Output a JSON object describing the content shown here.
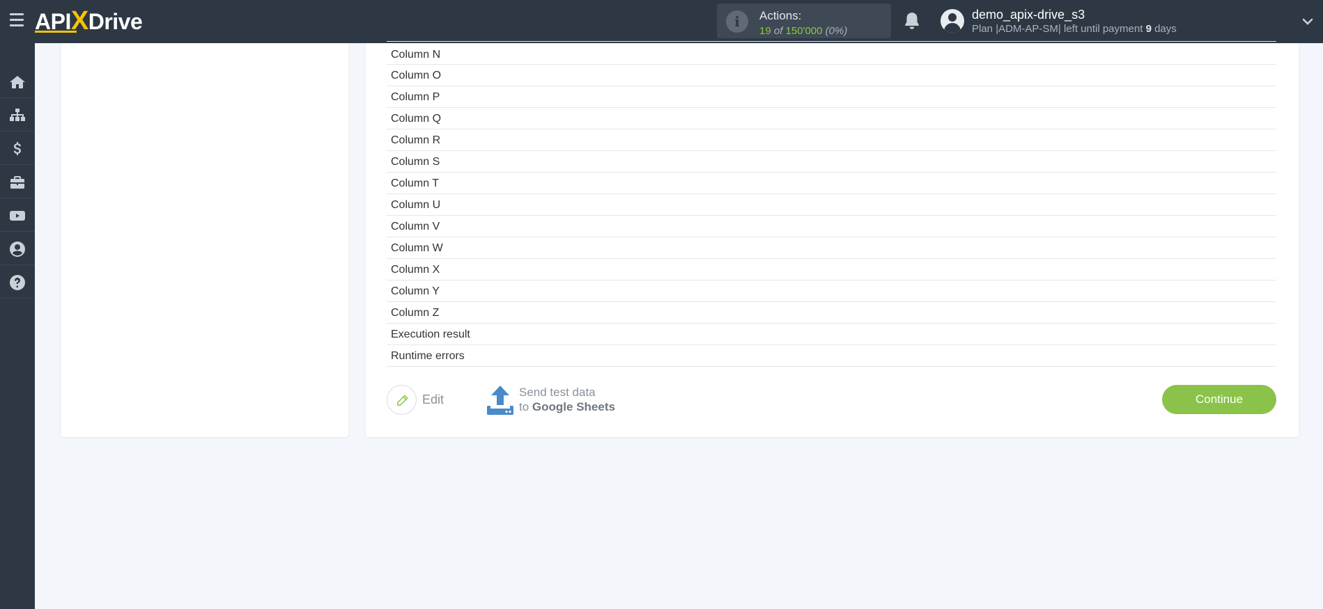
{
  "header": {
    "logo": {
      "left": "API",
      "x": "X",
      "right": "Drive"
    },
    "actions": {
      "label": "Actions:",
      "used": "19",
      "of": "of",
      "total": "150'000",
      "percent": "(0%)"
    },
    "user": {
      "name": "demo_apix-drive_s3",
      "plan_prefix": "Plan |ADM-AP-SM| left until payment",
      "days_count": "9",
      "days_suffix": "days"
    }
  },
  "sidebar": {
    "items": [
      {
        "icon": "home-icon"
      },
      {
        "icon": "sitemap-icon"
      },
      {
        "icon": "dollar-icon"
      },
      {
        "icon": "briefcase-icon"
      },
      {
        "icon": "youtube-icon"
      },
      {
        "icon": "user-circle-icon"
      },
      {
        "icon": "question-icon"
      }
    ]
  },
  "fields": [
    "Column N",
    "Column O",
    "Column P",
    "Column Q",
    "Column R",
    "Column S",
    "Column T",
    "Column U",
    "Column V",
    "Column W",
    "Column X",
    "Column Y",
    "Column Z",
    "Execution result",
    "Runtime errors"
  ],
  "footer": {
    "edit_label": "Edit",
    "send_line1": "Send test data",
    "send_line2_prefix": "to",
    "send_line2_target": "Google Sheets",
    "continue_label": "Continue"
  },
  "colors": {
    "topbar": "#2d3844",
    "accent_green": "#8bc34a",
    "logo_yellow": "#f5c400",
    "upload_blue": "#4a8ac9"
  }
}
